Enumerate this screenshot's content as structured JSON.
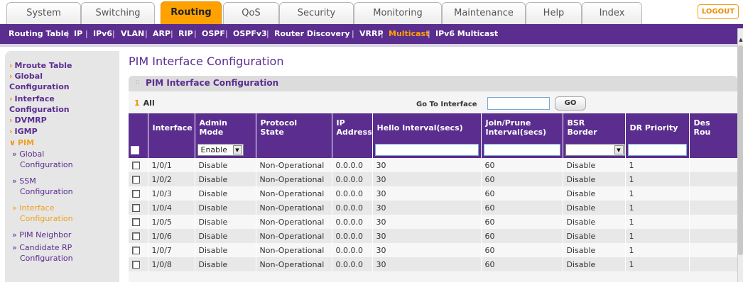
{
  "topnav": {
    "tabs": [
      {
        "label": "System"
      },
      {
        "label": "Switching"
      },
      {
        "label": "Routing"
      },
      {
        "label": "QoS"
      },
      {
        "label": "Security"
      },
      {
        "label": "Monitoring"
      },
      {
        "label": "Maintenance"
      },
      {
        "label": "Help"
      },
      {
        "label": "Index"
      }
    ],
    "active": "Routing",
    "logout_label": "LOGOUT"
  },
  "subnav": {
    "items": [
      {
        "label": "Routing Table"
      },
      {
        "label": "IP"
      },
      {
        "label": "IPv6"
      },
      {
        "label": "VLAN"
      },
      {
        "label": "ARP"
      },
      {
        "label": "RIP"
      },
      {
        "label": "OSPF"
      },
      {
        "label": "OSPFv3"
      },
      {
        "label": "Router Discovery"
      },
      {
        "label": "VRRP"
      },
      {
        "label": "Multicast"
      },
      {
        "label": "IPv6 Multicast"
      }
    ],
    "separator": "|",
    "active": "Multicast"
  },
  "sidebar": {
    "items": [
      {
        "label": "Mroute Table"
      },
      {
        "label_line1": "Global",
        "label_line2": "Configuration"
      },
      {
        "label_line1": "Interface",
        "label_line2": "Configuration"
      },
      {
        "label": "DVMRP"
      },
      {
        "label": "IGMP"
      },
      {
        "label": "PIM"
      }
    ],
    "pim_sub": [
      {
        "line1": "Global",
        "line2": "Configuration"
      },
      {
        "line1": "SSM",
        "line2": "Configuration"
      },
      {
        "line1": "Interface",
        "line2": "Configuration"
      },
      {
        "line1": "PIM Neighbor"
      },
      {
        "line1": "Candidate RP",
        "line2": "Configuration"
      }
    ],
    "arrow_collapsed": "›",
    "arrow_expanded": "∨",
    "sub_bullet": "»"
  },
  "page": {
    "title": "PIM Interface Configuration",
    "section_title": "PIM Interface Configuration",
    "section_dots": "::",
    "filter": {
      "number": "1",
      "all_label": "All",
      "goto_label": "Go To Interface",
      "goto_value": "",
      "go_label": "GO"
    }
  },
  "table": {
    "headers": [
      {
        "line1": "",
        "line2": ""
      },
      {
        "line1": "Interface",
        "line2": ""
      },
      {
        "line1": "Admin",
        "line2": "Mode"
      },
      {
        "line1": "Protocol",
        "line2": "State"
      },
      {
        "line1": "IP",
        "line2": "Address"
      },
      {
        "line1": "Hello Interval(secs)",
        "line2": ""
      },
      {
        "line1": "Join/Prune",
        "line2": "Interval(secs)"
      },
      {
        "line1": "BSR",
        "line2": "Border"
      },
      {
        "line1": "DR Priority",
        "line2": ""
      },
      {
        "line1": "Des",
        "line2": "Rou"
      }
    ],
    "edit_row": {
      "admin_mode": "Enable",
      "bsr_border": "",
      "hello": "",
      "join_prune": "",
      "dr_priority": ""
    },
    "rows": [
      {
        "interface": "1/0/1",
        "admin_mode": "Disable",
        "protocol_state": "Non-Operational",
        "ip": "0.0.0.0",
        "hello": "30",
        "join_prune": "60",
        "bsr_border": "Disable",
        "dr_priority": "1",
        "des": ""
      },
      {
        "interface": "1/0/2",
        "admin_mode": "Disable",
        "protocol_state": "Non-Operational",
        "ip": "0.0.0.0",
        "hello": "30",
        "join_prune": "60",
        "bsr_border": "Disable",
        "dr_priority": "1",
        "des": ""
      },
      {
        "interface": "1/0/3",
        "admin_mode": "Disable",
        "protocol_state": "Non-Operational",
        "ip": "0.0.0.0",
        "hello": "30",
        "join_prune": "60",
        "bsr_border": "Disable",
        "dr_priority": "1",
        "des": ""
      },
      {
        "interface": "1/0/4",
        "admin_mode": "Disable",
        "protocol_state": "Non-Operational",
        "ip": "0.0.0.0",
        "hello": "30",
        "join_prune": "60",
        "bsr_border": "Disable",
        "dr_priority": "1",
        "des": ""
      },
      {
        "interface": "1/0/5",
        "admin_mode": "Disable",
        "protocol_state": "Non-Operational",
        "ip": "0.0.0.0",
        "hello": "30",
        "join_prune": "60",
        "bsr_border": "Disable",
        "dr_priority": "1",
        "des": ""
      },
      {
        "interface": "1/0/6",
        "admin_mode": "Disable",
        "protocol_state": "Non-Operational",
        "ip": "0.0.0.0",
        "hello": "30",
        "join_prune": "60",
        "bsr_border": "Disable",
        "dr_priority": "1",
        "des": ""
      },
      {
        "interface": "1/0/7",
        "admin_mode": "Disable",
        "protocol_state": "Non-Operational",
        "ip": "0.0.0.0",
        "hello": "30",
        "join_prune": "60",
        "bsr_border": "Disable",
        "dr_priority": "1",
        "des": ""
      },
      {
        "interface": "1/0/8",
        "admin_mode": "Disable",
        "protocol_state": "Non-Operational",
        "ip": "0.0.0.0",
        "hello": "30",
        "join_prune": "60",
        "bsr_border": "Disable",
        "dr_priority": "1",
        "des": ""
      }
    ]
  },
  "icons": {
    "select_arrow": "▼",
    "scroll_up": "▲"
  },
  "colors": {
    "brand_purple": "#5a2d8f",
    "accent_orange": "#ffa200"
  }
}
